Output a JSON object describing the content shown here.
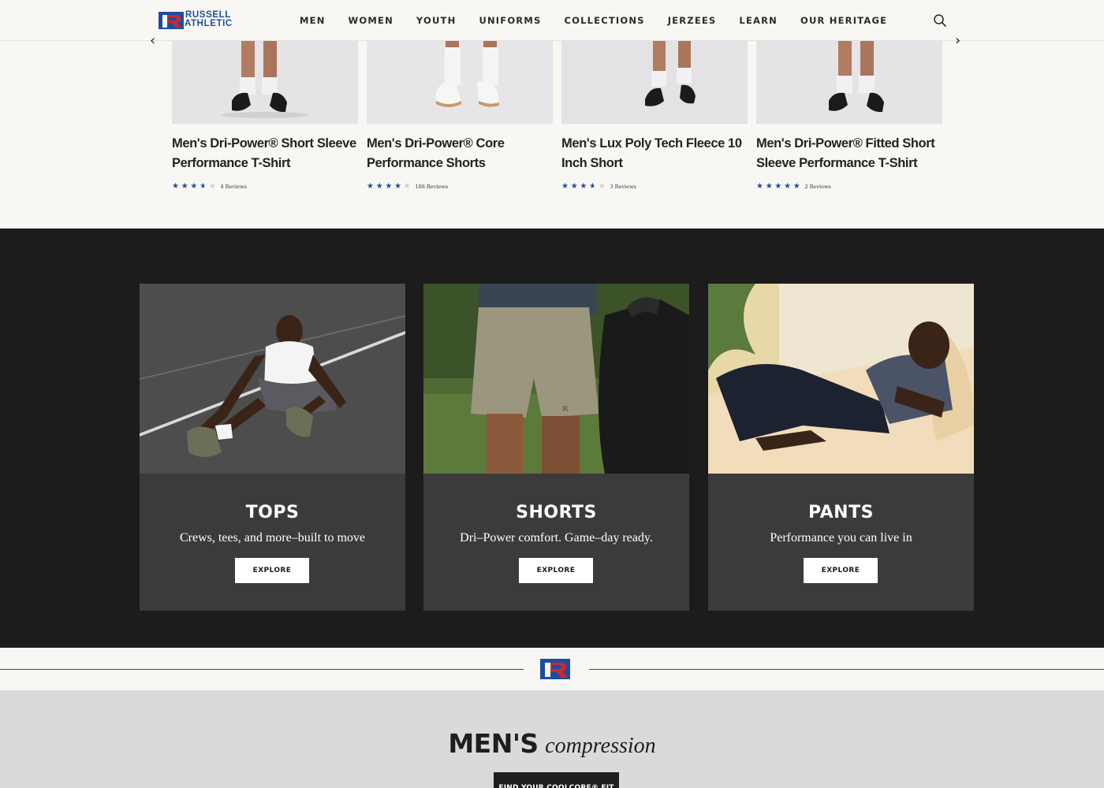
{
  "header": {
    "logo_text_line1": "RUSSELL",
    "logo_text_line2": "ATHLETIC",
    "nav": [
      "MEN",
      "WOMEN",
      "YOUTH",
      "UNIFORMS",
      "COLLECTIONS",
      "JERZEES",
      "LEARN",
      "OUR HERITAGE"
    ],
    "search_icon": "search-icon"
  },
  "carousel": {
    "prev_icon": "chevron-left-icon",
    "next_icon": "chevron-right-icon",
    "products": [
      {
        "name": "Men's Dri-Power® Short Sleeve Performance T-Shirt",
        "rating": 3.5,
        "reviews": "4 Reviews"
      },
      {
        "name": "Men's Dri-Power® Core Performance Shorts",
        "rating": 4,
        "reviews": "188 Reviews"
      },
      {
        "name": "Men's Lux Poly Tech Fleece 10 Inch Short",
        "rating": 3.5,
        "reviews": "3 Reviews"
      },
      {
        "name": "Men's Dri-Power® Fitted Short Sleeve Performance T-Shirt",
        "rating": 5,
        "reviews": "2 Reviews"
      }
    ]
  },
  "categories": [
    {
      "title": "TOPS",
      "subtitle": "Crews, tees, and more–built to move",
      "button": "EXPLORE"
    },
    {
      "title": "SHORTS",
      "subtitle": "Dri–Power comfort. Game–day ready.",
      "button": "EXPLORE"
    },
    {
      "title": "PANTS",
      "subtitle": "Performance you can live in",
      "button": "EXPLORE"
    }
  ],
  "compression": {
    "title_strong": "MEN'S",
    "title_italic": "compression",
    "button": "FIND YOUR COOLCORE® FIT"
  },
  "colors": {
    "brand_blue": "#1d4e9e",
    "brand_red": "#d22630",
    "dark_bg": "#1c1c1c",
    "card_bg": "#3b3b3b"
  }
}
